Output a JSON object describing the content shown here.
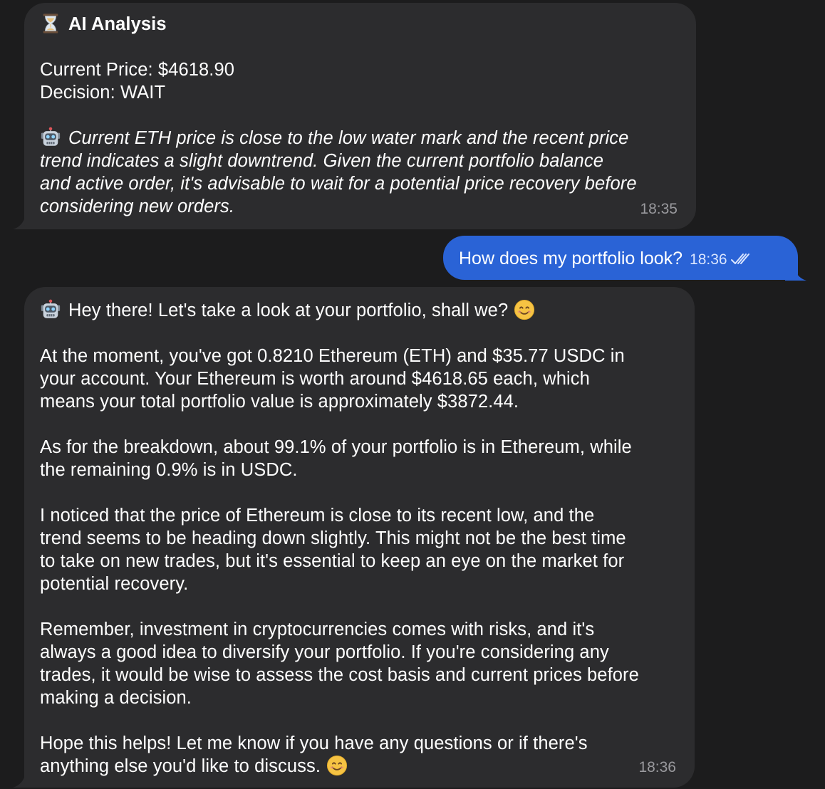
{
  "messages": {
    "analysis": {
      "title": "AI Analysis",
      "price_line": "Current Price: $4618.90",
      "decision_line": "Decision: WAIT",
      "reason_lines": [
        "Current ETH price is close to the low water mark and the recent price",
        "trend indicates a slight downtrend. Given the current portfolio balance",
        "and active order, it's advisable to wait for a potential price recovery before",
        "considering new orders."
      ],
      "time": "18:35",
      "icons": [
        "hourglass-icon",
        "robot-icon"
      ]
    },
    "user": {
      "text": "How does my portfolio look?",
      "time": "18:36",
      "status_icon": "double-check-icon"
    },
    "reply": {
      "greeting": "Hey there! Let's take a look at your portfolio, shall we?",
      "p1": [
        "At the moment, you've got 0.8210 Ethereum (ETH) and $35.77 USDC in",
        "your account. Your Ethereum is worth around $4618.65 each, which",
        "means your total portfolio value is approximately $3872.44."
      ],
      "p2": [
        "As for the breakdown, about 99.1% of your portfolio is in Ethereum, while",
        "the remaining 0.9% is in USDC."
      ],
      "p3": [
        "I noticed that the price of Ethereum is close to its recent low, and the",
        "trend seems to be heading down slightly. This might not be the best time",
        "to take on new trades, but it's essential to keep an eye on the market for",
        "potential recovery."
      ],
      "p4": [
        "Remember, investment in cryptocurrencies comes with risks, and it's",
        "always a good idea to diversify your portfolio. If you're considering any",
        "trades, it would be wise to assess the cost basis and current prices before",
        "making a decision."
      ],
      "p5": [
        "Hope this helps! Let me know if you have any questions or if there's",
        "anything else you'd like to discuss."
      ],
      "time": "18:36",
      "icons": [
        "robot-icon",
        "smiling-face-icon"
      ]
    }
  },
  "colors": {
    "background": "#1c1c1d",
    "incoming_bubble": "#2c2c2e",
    "outgoing_bubble": "#2a63d6",
    "timestamp": "#9a9a9e"
  }
}
